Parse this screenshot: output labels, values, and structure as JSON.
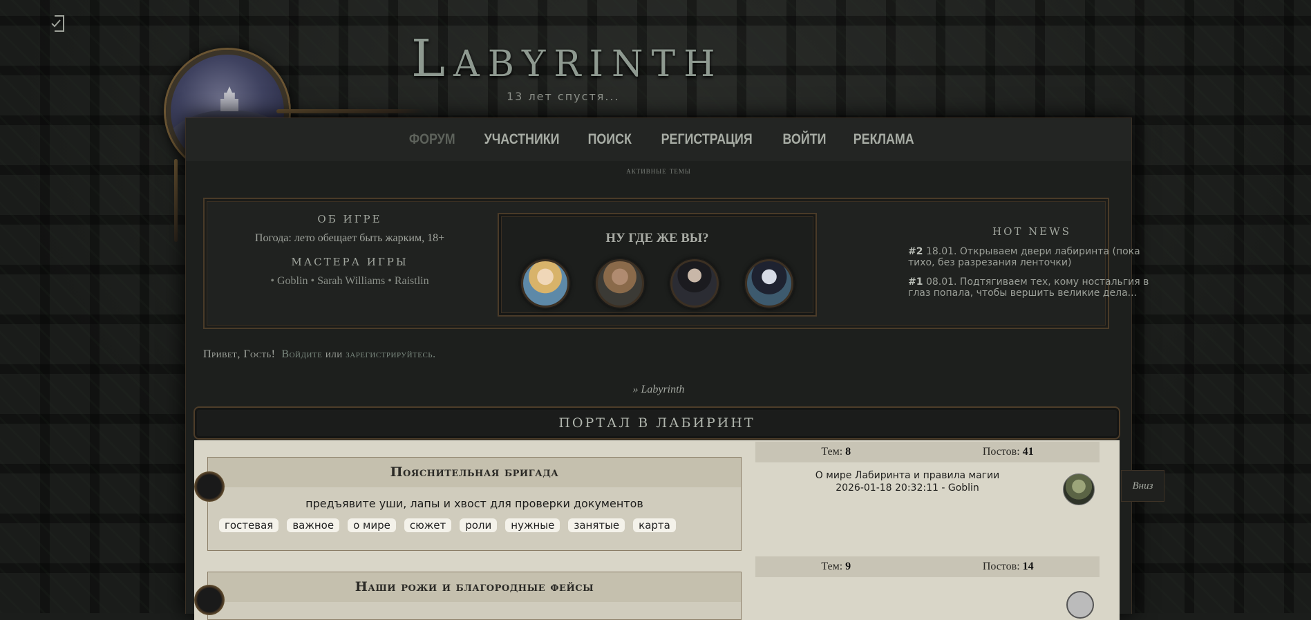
{
  "header": {
    "title": "Labyrinth",
    "subtitle": "13 лет спустя..."
  },
  "nav": {
    "items": [
      {
        "label": "ФОРУМ",
        "active": true
      },
      {
        "label": "УЧАСТНИКИ"
      },
      {
        "label": "ПОИСК"
      },
      {
        "label": "РЕГИСТРАЦИЯ"
      },
      {
        "label": "ВОЙТИ"
      },
      {
        "label": "РЕКЛАМА"
      }
    ],
    "sub": "активные темы"
  },
  "about": {
    "title": "ОБ ИГРЕ",
    "weather": "Погода: лето обещает быть жарким, 18+",
    "masters_title": "МАСТЕРА ИГРЫ",
    "masters": [
      "Goblin",
      "Sarah Williams",
      "Raistlin"
    ]
  },
  "where": {
    "title": "НУ ГДЕ ЖЕ ВЫ?"
  },
  "news": {
    "title": "HOT NEWS",
    "items": [
      {
        "num": "#2",
        "text": "18.01. Открываем двери лабиринта (пока тихо, без разрезания ленточки)"
      },
      {
        "num": "#1",
        "text": "08.01. Подтягиваем тех, кому ностальгия в глаз попала, чтобы вершить великие дела..."
      }
    ]
  },
  "greeting": {
    "prefix": "Привет, Гость!",
    "login": "Войдите",
    "or": "или",
    "register": "зарегистрируйтесь."
  },
  "breadcrumb": "» Labyrinth",
  "category": {
    "title": "ПОРТАЛ В ЛАБИРИНТ"
  },
  "forums": [
    {
      "title": "Пояснительная бригада",
      "description": "предъявите уши, лапы и хвост для проверки документов",
      "tags": [
        "гостевая",
        "важное",
        "о мире",
        "сюжет",
        "роли",
        "нужные",
        "занятые",
        "карта"
      ],
      "topics_label": "Тем:",
      "topics": "8",
      "posts_label": "Постов:",
      "posts": "41",
      "last_topic": "О мире Лабиринта и правила магии",
      "last_time": "2026-01-18 20:32:11 - Goblin"
    },
    {
      "title": "Наши рожи и благородные фейсы",
      "topics_label": "Тем:",
      "topics": "9",
      "posts_label": "Постов:",
      "posts": "14"
    }
  ],
  "down_button": "Вниз"
}
